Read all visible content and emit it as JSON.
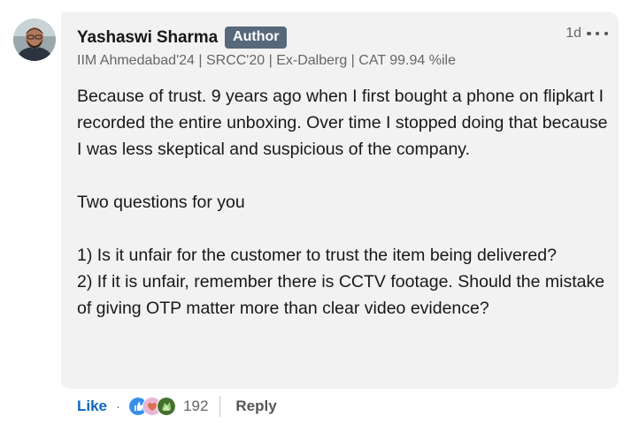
{
  "comment": {
    "author": {
      "name": "Yashaswi Sharma",
      "badge": "Author",
      "headline": "IIM Ahmedabad'24 | SRCC'20 | Ex-Dalberg | CAT 99.94 %ile",
      "avatar_icon": "profile-photo"
    },
    "timestamp": "1d",
    "more_icon": "ellipsis-icon",
    "body": {
      "p1": "Because of trust. 9 years ago when I first bought a phone on flipkart I recorded the entire unboxing. Over time I stopped doing that because I was less skeptical and suspicious of the company.",
      "p2": "Two questions for you",
      "p3a": "1) Is it unfair for the customer to trust the item being delivered?",
      "p3b": "2) If it is unfair, remember there is CCTV footage. Should the mistake of giving OTP matter more than clear video evidence?"
    }
  },
  "actions": {
    "like_label": "Like",
    "separator": "·",
    "reactions": [
      "like-icon",
      "love-icon",
      "celebrate-icon"
    ],
    "reaction_count": "192",
    "reply_label": "Reply"
  },
  "colors": {
    "link_blue": "#0a66c2",
    "badge_bg": "#56687a",
    "bubble_bg": "#f2f2f2"
  }
}
